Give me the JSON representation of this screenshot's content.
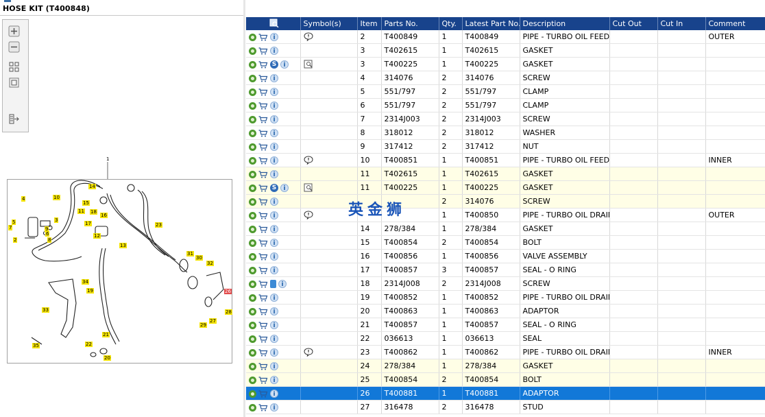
{
  "window": {
    "title": "HOSE KIT (T400848)"
  },
  "toolbar": {
    "icons": [
      "zoom-in-icon",
      "zoom-out-icon",
      "fit-page-icon",
      "actual-size-icon",
      "export-icon"
    ]
  },
  "drawing": {
    "main_label": "1",
    "callouts": [
      "14",
      "4",
      "10",
      "15",
      "18",
      "16",
      "3",
      "17",
      "5",
      "7",
      "9",
      "6",
      "8",
      "2",
      "12",
      "23",
      "13",
      "31",
      "30",
      "32",
      "34",
      "19",
      "26",
      "33",
      "27",
      "28",
      "29",
      "21",
      "22",
      "35",
      "20",
      "11"
    ]
  },
  "watermark": "英金狮",
  "table": {
    "headers": [
      "",
      "Symbol(s)",
      "Item",
      "Parts No.",
      "Qty.",
      "Latest Part No.",
      "Description",
      "Cut Out",
      "Cut In",
      "Comment"
    ],
    "rows": [
      {
        "icons": "gc_i",
        "sym": "bubble",
        "item": "2",
        "part": "T400849",
        "qty": "1",
        "latest": "T400849",
        "desc": "PIPE - TURBO OIL FEED",
        "cutout": "",
        "cutin": "",
        "comment": "OUTER",
        "style": ""
      },
      {
        "icons": "gc_i",
        "sym": "",
        "item": "3",
        "part": "T402615",
        "qty": "1",
        "latest": "T402615",
        "desc": "GASKET",
        "cutout": "",
        "cutin": "",
        "comment": "",
        "style": ""
      },
      {
        "icons": "gc_s_i",
        "sym": "book",
        "item": "3",
        "part": "T400225",
        "qty": "1",
        "latest": "T400225",
        "desc": "GASKET",
        "cutout": "",
        "cutin": "",
        "comment": "",
        "style": ""
      },
      {
        "icons": "gc_i",
        "sym": "",
        "item": "4",
        "part": "314076",
        "qty": "2",
        "latest": "314076",
        "desc": "SCREW",
        "cutout": "",
        "cutin": "",
        "comment": "",
        "style": ""
      },
      {
        "icons": "gc_i",
        "sym": "",
        "item": "5",
        "part": "551/797",
        "qty": "2",
        "latest": "551/797",
        "desc": "CLAMP",
        "cutout": "",
        "cutin": "",
        "comment": "",
        "style": ""
      },
      {
        "icons": "gc_i",
        "sym": "",
        "item": "6",
        "part": "551/797",
        "qty": "2",
        "latest": "551/797",
        "desc": "CLAMP",
        "cutout": "",
        "cutin": "",
        "comment": "",
        "style": ""
      },
      {
        "icons": "gc_i",
        "sym": "",
        "item": "7",
        "part": "2314J003",
        "qty": "2",
        "latest": "2314J003",
        "desc": "SCREW",
        "cutout": "",
        "cutin": "",
        "comment": "",
        "style": ""
      },
      {
        "icons": "gc_i",
        "sym": "",
        "item": "8",
        "part": "318012",
        "qty": "2",
        "latest": "318012",
        "desc": "WASHER",
        "cutout": "",
        "cutin": "",
        "comment": "",
        "style": ""
      },
      {
        "icons": "gc_i",
        "sym": "",
        "item": "9",
        "part": "317412",
        "qty": "2",
        "latest": "317412",
        "desc": "NUT",
        "cutout": "",
        "cutin": "",
        "comment": "",
        "style": ""
      },
      {
        "icons": "gc_i",
        "sym": "bubble",
        "item": "10",
        "part": "T400851",
        "qty": "1",
        "latest": "T400851",
        "desc": "PIPE - TURBO OIL FEED",
        "cutout": "",
        "cutin": "",
        "comment": "INNER",
        "style": ""
      },
      {
        "icons": "gc_i",
        "sym": "",
        "item": "11",
        "part": "T402615",
        "qty": "1",
        "latest": "T402615",
        "desc": "GASKET",
        "cutout": "",
        "cutin": "",
        "comment": "",
        "style": "alt"
      },
      {
        "icons": "gc_s_i",
        "sym": "book",
        "item": "11",
        "part": "T400225",
        "qty": "1",
        "latest": "T400225",
        "desc": "GASKET",
        "cutout": "",
        "cutin": "",
        "comment": "",
        "style": "alt"
      },
      {
        "icons": "gc_i",
        "sym": "",
        "item": "",
        "part": "",
        "qty": "2",
        "latest": "314076",
        "desc": "SCREW",
        "cutout": "",
        "cutin": "",
        "comment": "",
        "style": "alt"
      },
      {
        "icons": "gc_i",
        "sym": "bubble",
        "item": "",
        "part": "",
        "qty": "1",
        "latest": "T400850",
        "desc": "PIPE - TURBO OIL DRAIN",
        "cutout": "",
        "cutin": "",
        "comment": "OUTER",
        "style": ""
      },
      {
        "icons": "gc_i",
        "sym": "",
        "item": "14",
        "part": "278/384",
        "qty": "1",
        "latest": "278/384",
        "desc": "GASKET",
        "cutout": "",
        "cutin": "",
        "comment": "",
        "style": ""
      },
      {
        "icons": "gc_i",
        "sym": "",
        "item": "15",
        "part": "T400854",
        "qty": "2",
        "latest": "T400854",
        "desc": "BOLT",
        "cutout": "",
        "cutin": "",
        "comment": "",
        "style": ""
      },
      {
        "icons": "gc_i",
        "sym": "",
        "item": "16",
        "part": "T400856",
        "qty": "1",
        "latest": "T400856",
        "desc": "VALVE ASSEMBLY",
        "cutout": "",
        "cutin": "",
        "comment": "",
        "style": ""
      },
      {
        "icons": "gc_i",
        "sym": "",
        "item": "17",
        "part": "T400857",
        "qty": "3",
        "latest": "T400857",
        "desc": "SEAL - O RING",
        "cutout": "",
        "cutin": "",
        "comment": "",
        "style": ""
      },
      {
        "icons": "gc_doc_i",
        "sym": "",
        "item": "18",
        "part": "2314J008",
        "qty": "2",
        "latest": "2314J008",
        "desc": "SCREW",
        "cutout": "",
        "cutin": "",
        "comment": "",
        "style": ""
      },
      {
        "icons": "gc_i",
        "sym": "",
        "item": "19",
        "part": "T400852",
        "qty": "1",
        "latest": "T400852",
        "desc": "PIPE - TURBO OIL DRAIN",
        "cutout": "",
        "cutin": "",
        "comment": "",
        "style": ""
      },
      {
        "icons": "gc_i",
        "sym": "",
        "item": "20",
        "part": "T400863",
        "qty": "1",
        "latest": "T400863",
        "desc": "ADAPTOR",
        "cutout": "",
        "cutin": "",
        "comment": "",
        "style": ""
      },
      {
        "icons": "gc_i",
        "sym": "",
        "item": "21",
        "part": "T400857",
        "qty": "1",
        "latest": "T400857",
        "desc": "SEAL - O RING",
        "cutout": "",
        "cutin": "",
        "comment": "",
        "style": ""
      },
      {
        "icons": "gc_i",
        "sym": "",
        "item": "22",
        "part": "036613",
        "qty": "1",
        "latest": "036613",
        "desc": "SEAL",
        "cutout": "",
        "cutin": "",
        "comment": "",
        "style": ""
      },
      {
        "icons": "gc_i",
        "sym": "bubble",
        "item": "23",
        "part": "T400862",
        "qty": "1",
        "latest": "T400862",
        "desc": "PIPE - TURBO OIL DRAIN",
        "cutout": "",
        "cutin": "",
        "comment": "INNER",
        "style": ""
      },
      {
        "icons": "gc_i",
        "sym": "",
        "item": "24",
        "part": "278/384",
        "qty": "1",
        "latest": "278/384",
        "desc": "GASKET",
        "cutout": "",
        "cutin": "",
        "comment": "",
        "style": "alt"
      },
      {
        "icons": "gc_i",
        "sym": "",
        "item": "25",
        "part": "T400854",
        "qty": "2",
        "latest": "T400854",
        "desc": "BOLT",
        "cutout": "",
        "cutin": "",
        "comment": "",
        "style": "alt"
      },
      {
        "icons": "gc_i",
        "sym": "",
        "item": "26",
        "part": "T400881",
        "qty": "1",
        "latest": "T400881",
        "desc": "ADAPTOR",
        "cutout": "",
        "cutin": "",
        "comment": "",
        "style": "sel"
      },
      {
        "icons": "gc_i",
        "sym": "",
        "item": "27",
        "part": "316478",
        "qty": "2",
        "latest": "316478",
        "desc": "STUD",
        "cutout": "",
        "cutin": "",
        "comment": "",
        "style": ""
      }
    ]
  }
}
